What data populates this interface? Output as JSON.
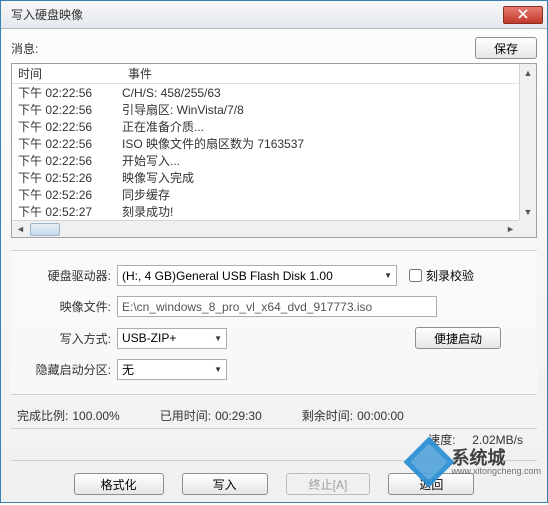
{
  "window": {
    "title": "写入硬盘映像"
  },
  "topbar": {
    "message_label": "消息:",
    "save_btn": "保存"
  },
  "log": {
    "header_time": "时间",
    "header_event": "事件",
    "rows": [
      {
        "time": "下午 02:22:56",
        "event": "C/H/S: 458/255/63"
      },
      {
        "time": "下午 02:22:56",
        "event": "引导扇区: WinVista/7/8"
      },
      {
        "time": "下午 02:22:56",
        "event": "正在准备介质..."
      },
      {
        "time": "下午 02:22:56",
        "event": "ISO 映像文件的扇区数为 7163537"
      },
      {
        "time": "下午 02:22:56",
        "event": "开始写入..."
      },
      {
        "time": "下午 02:52:26",
        "event": "映像写入完成"
      },
      {
        "time": "下午 02:52:26",
        "event": "同步缓存"
      },
      {
        "time": "下午 02:52:27",
        "event": "刻录成功!"
      }
    ]
  },
  "form": {
    "drive_label": "硬盘驱动器:",
    "drive_value": "(H:, 4 GB)General USB Flash Disk  1.00",
    "verify_label": "刻录校验",
    "image_label": "映像文件:",
    "image_value": "E:\\cn_windows_8_pro_vl_x64_dvd_917773.iso",
    "mode_label": "写入方式:",
    "mode_value": "USB-ZIP+",
    "quickboot_btn": "便捷启动",
    "hidden_label": "隐藏启动分区:",
    "hidden_value": "无"
  },
  "stats": {
    "pct_label": "完成比例:",
    "pct_value": "100.00%",
    "used_label": "已用时间:",
    "used_value": "00:29:30",
    "remain_label": "剩余时间:",
    "remain_value": "00:00:00",
    "speed_label": "速度:",
    "speed_value": "2.02MB/s"
  },
  "buttons": {
    "format": "格式化",
    "write": "写入",
    "abort": "终止[A]",
    "back": "返回"
  },
  "watermark": {
    "brand": "系统城",
    "url": "www.xitongcheng.com"
  }
}
